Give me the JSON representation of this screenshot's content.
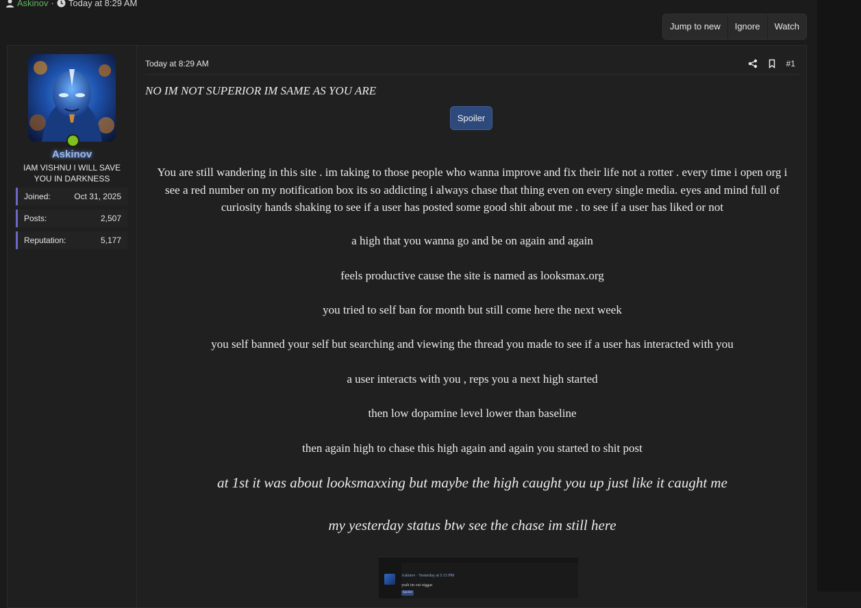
{
  "thread_meta": {
    "author": "Askinov",
    "separator": "·",
    "date": "Today at 8:29 AM"
  },
  "thread_actions": {
    "jump_to_new": "Jump to new",
    "ignore": "Ignore",
    "watch": "Watch"
  },
  "user": {
    "name": "Askinov",
    "title": "IAM VISHNU I WILL SAVE YOU IN DARKNESS",
    "online": true,
    "stats": [
      {
        "label": "Joined:",
        "value": "Oct 31, 2025"
      },
      {
        "label": "Posts:",
        "value": "2,507"
      },
      {
        "label": "Reputation:",
        "value": "5,177"
      }
    ]
  },
  "post": {
    "date": "Today at 8:29 AM",
    "number": "#1",
    "first_line": "NO IM NOT SUPERIOR IM SAME AS YOU ARE",
    "spoiler_label": "Spoiler",
    "paragraph": "You are still wandering in this site . im taking to those people who wanna improve and fix their life not a rotter . every time i open org i see a red number on my notification box its so addicting i always chase that thing even on every single media. eyes and mind full of curiosity hands shaking to see if a user has posted some good shit about me . to see if a user has liked or not",
    "lines": [
      "a high that you wanna go and be on again and again",
      "feels productive cause the site is named as looksmax.org",
      "you tried to self ban for month but still come here the next week",
      "you self banned your self but searching and viewing the thread you made to see if a user has interacted with you",
      "a user interacts with you , reps you a next high started",
      "then low dopamine level lower than baseline",
      "then again high to chase this high again and again you started to shit post"
    ],
    "big_lines": [
      "at 1st it was about looksmaxxing but maybe the high caught you up just like it caught me",
      "my yesterday status btw see the chase im still here"
    ],
    "embedded_screenshot": {
      "name": "Askinov · Yesterday at 5:13 PM",
      "text": "yeah im out niggas",
      "button": "Spoiler"
    }
  },
  "icons": {
    "user": "user-icon",
    "clock": "clock-icon",
    "share": "share-icon",
    "bookmark": "bookmark-icon"
  },
  "colors": {
    "author_link": "#5cb85c",
    "username": "#9cb8e8",
    "online": "#7cc21b",
    "spoiler": "#2e4a7c",
    "accent_bar": "#6c68c9"
  }
}
